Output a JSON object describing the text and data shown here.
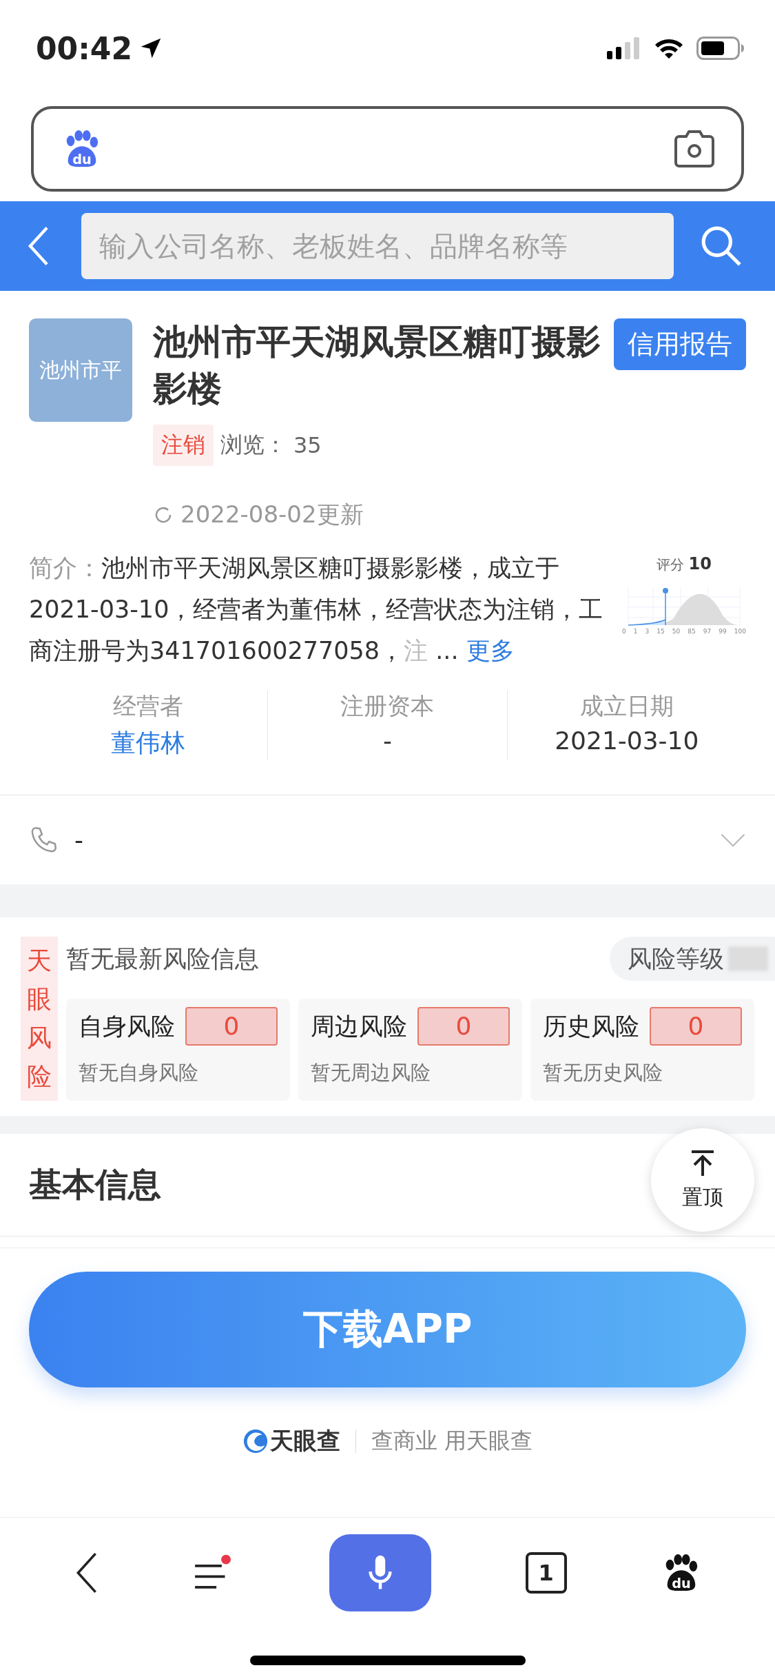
{
  "status_bar": {
    "time": "00:42"
  },
  "browser_bar": {
    "logo_text": "du"
  },
  "header": {
    "search_placeholder": "输入公司名称、老板姓名、品牌名称等"
  },
  "company": {
    "logo_text": "池州市平",
    "name": "池州市平天湖风景区糖叮摄影影楼",
    "report_button": "信用报告",
    "status_tag": "注销",
    "views_label": "浏览：",
    "views": "35",
    "updated": "2022-08-02更新",
    "intro_label": "简介：",
    "intro_text": "池州市平天湖风景区糖叮摄影影楼，成立于2021-03-10，经营者为董伟林，经营状态为注销，工商注册号为341701600277058，",
    "intro_cut": "注",
    "intro_ellipsis": "...",
    "more_link": "更多",
    "score": {
      "label": "评分",
      "value": "10",
      "ticks": [
        "0",
        "1",
        "3",
        "15",
        "50",
        "85",
        "97",
        "99",
        "100"
      ]
    }
  },
  "key_info": [
    {
      "label": "经营者",
      "value": "董伟林",
      "link": true
    },
    {
      "label": "注册资本",
      "value": "-",
      "link": false
    },
    {
      "label": "成立日期",
      "value": "2021-03-10",
      "link": false
    }
  ],
  "phone": {
    "value": "-"
  },
  "risk": {
    "side_label": "天眼风险",
    "headline": "暂无最新风险信息",
    "level_label": "风险等级",
    "cards": [
      {
        "name": "自身风险",
        "count": "0",
        "note": "暂无自身风险"
      },
      {
        "name": "周边风险",
        "count": "0",
        "note": "暂无周边风险"
      },
      {
        "name": "历史风险",
        "count": "0",
        "note": "暂无历史风险"
      }
    ]
  },
  "basic_info": {
    "title": "基本信息"
  },
  "top_button": {
    "label": "置顶"
  },
  "download_button": "下载APP",
  "footer": {
    "brand": "天眼查",
    "slogan": "查商业 用天眼查"
  },
  "nav": {
    "menu_badge": true,
    "tab_count": "1",
    "logo_text": "du"
  }
}
